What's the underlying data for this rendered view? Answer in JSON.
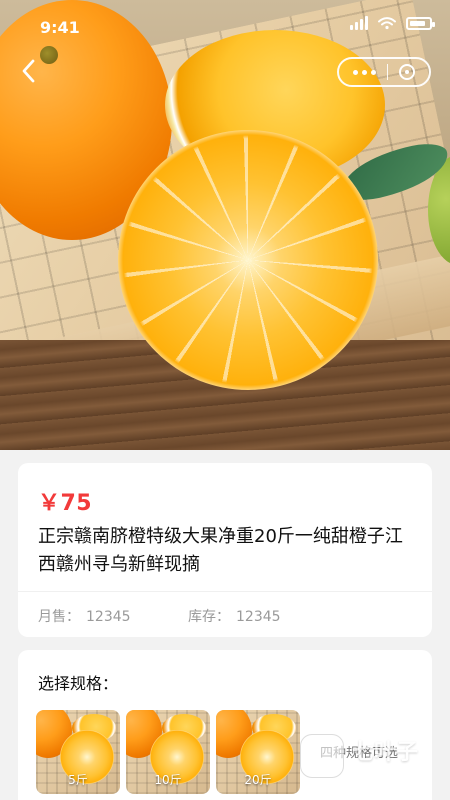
{
  "status_bar": {
    "time": "9:41",
    "battery_level": 0.85
  },
  "nav": {
    "back_icon": "chevron-left-icon",
    "more_icon": "more-dots-icon",
    "close_icon": "target-icon"
  },
  "product": {
    "price": "￥75",
    "title": "正宗赣南脐橙特级大果净重20斤一纯甜橙子江西赣州寻乌新鲜现摘",
    "sales_label": "月售：",
    "sales_value": "12345",
    "stock_label": "库存：",
    "stock_value": "12345"
  },
  "spec": {
    "title": "选择规格：",
    "options": [
      {
        "label": "5斤"
      },
      {
        "label": "10斤"
      },
      {
        "label": "20斤"
      }
    ],
    "hint": "四种规格可选"
  },
  "watermark": {
    "brand": "七叶子",
    "site": "7YZ.COM"
  },
  "colors": {
    "price_red": "#f23a3a",
    "page_bg": "#f2f2f2",
    "card_bg": "#ffffff"
  }
}
